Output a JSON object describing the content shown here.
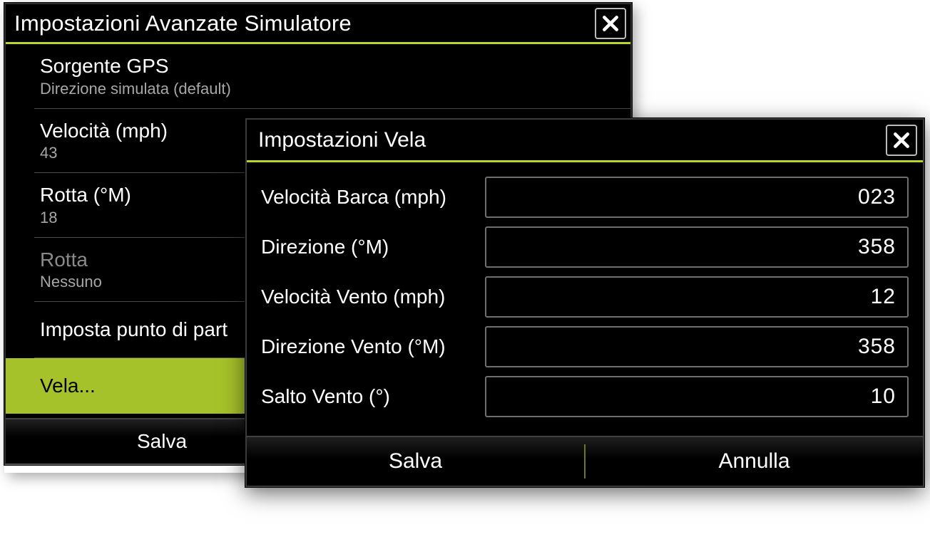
{
  "colors": {
    "accent": "#b8d430"
  },
  "back": {
    "title": "Impostazioni Avanzate Simulatore",
    "close_icon": "close-icon",
    "rows": {
      "gps": {
        "title": "Sorgente GPS",
        "sub": "Direzione simulata (default)"
      },
      "speed": {
        "title": "Velocità (mph)",
        "sub": "43"
      },
      "course": {
        "title": "Rotta (°M)",
        "sub": "18"
      },
      "route": {
        "title": "Rotta",
        "sub": "Nessuno"
      },
      "start": {
        "title": "Imposta punto di part"
      },
      "sail": {
        "title": "Vela..."
      }
    },
    "footer": {
      "save": "Salva"
    }
  },
  "front": {
    "title": "Impostazioni Vela",
    "close_icon": "close-icon",
    "fields": {
      "boat_speed": {
        "label": "Velocità Barca (mph)",
        "value": "023"
      },
      "heading": {
        "label": "Direzione (°M)",
        "value": "358"
      },
      "wind_speed": {
        "label": "Velocità Vento (mph)",
        "value": "12"
      },
      "wind_dir": {
        "label": "Direzione Vento (°M)",
        "value": "358"
      },
      "wind_shift": {
        "label": "Salto Vento (°)",
        "value": "10"
      }
    },
    "buttons": {
      "save": "Salva",
      "cancel": "Annulla"
    }
  }
}
